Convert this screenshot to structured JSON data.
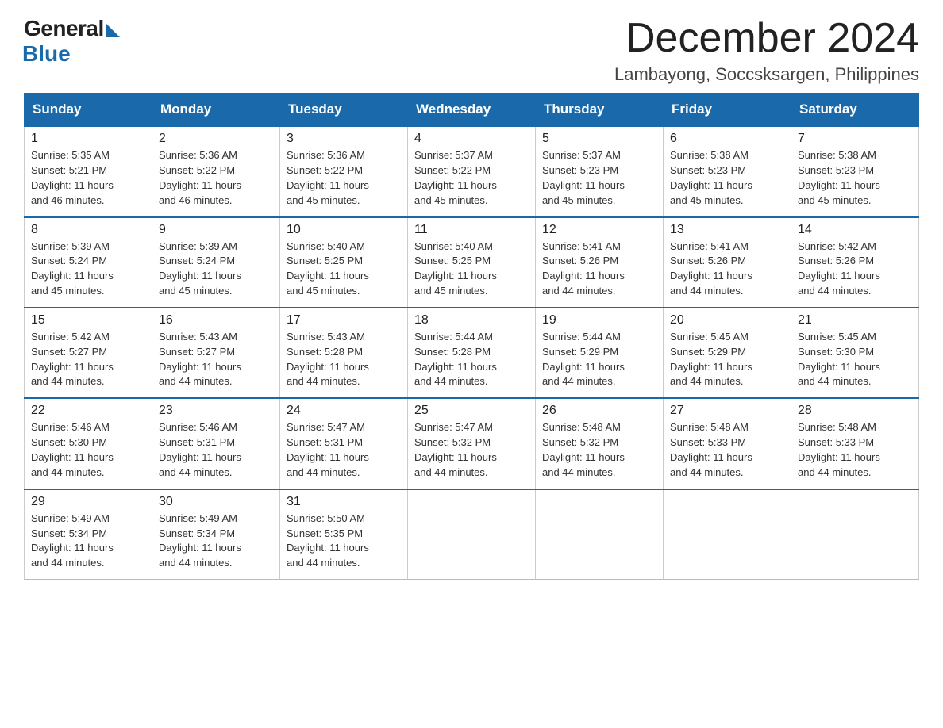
{
  "header": {
    "logo_general": "General",
    "logo_blue": "Blue",
    "month_title": "December 2024",
    "location": "Lambayong, Soccsksargen, Philippines"
  },
  "weekdays": [
    "Sunday",
    "Monday",
    "Tuesday",
    "Wednesday",
    "Thursday",
    "Friday",
    "Saturday"
  ],
  "weeks": [
    [
      {
        "day": "1",
        "sunrise": "5:35 AM",
        "sunset": "5:21 PM",
        "daylight": "11 hours and 46 minutes."
      },
      {
        "day": "2",
        "sunrise": "5:36 AM",
        "sunset": "5:22 PM",
        "daylight": "11 hours and 46 minutes."
      },
      {
        "day": "3",
        "sunrise": "5:36 AM",
        "sunset": "5:22 PM",
        "daylight": "11 hours and 45 minutes."
      },
      {
        "day": "4",
        "sunrise": "5:37 AM",
        "sunset": "5:22 PM",
        "daylight": "11 hours and 45 minutes."
      },
      {
        "day": "5",
        "sunrise": "5:37 AM",
        "sunset": "5:23 PM",
        "daylight": "11 hours and 45 minutes."
      },
      {
        "day": "6",
        "sunrise": "5:38 AM",
        "sunset": "5:23 PM",
        "daylight": "11 hours and 45 minutes."
      },
      {
        "day": "7",
        "sunrise": "5:38 AM",
        "sunset": "5:23 PM",
        "daylight": "11 hours and 45 minutes."
      }
    ],
    [
      {
        "day": "8",
        "sunrise": "5:39 AM",
        "sunset": "5:24 PM",
        "daylight": "11 hours and 45 minutes."
      },
      {
        "day": "9",
        "sunrise": "5:39 AM",
        "sunset": "5:24 PM",
        "daylight": "11 hours and 45 minutes."
      },
      {
        "day": "10",
        "sunrise": "5:40 AM",
        "sunset": "5:25 PM",
        "daylight": "11 hours and 45 minutes."
      },
      {
        "day": "11",
        "sunrise": "5:40 AM",
        "sunset": "5:25 PM",
        "daylight": "11 hours and 45 minutes."
      },
      {
        "day": "12",
        "sunrise": "5:41 AM",
        "sunset": "5:26 PM",
        "daylight": "11 hours and 44 minutes."
      },
      {
        "day": "13",
        "sunrise": "5:41 AM",
        "sunset": "5:26 PM",
        "daylight": "11 hours and 44 minutes."
      },
      {
        "day": "14",
        "sunrise": "5:42 AM",
        "sunset": "5:26 PM",
        "daylight": "11 hours and 44 minutes."
      }
    ],
    [
      {
        "day": "15",
        "sunrise": "5:42 AM",
        "sunset": "5:27 PM",
        "daylight": "11 hours and 44 minutes."
      },
      {
        "day": "16",
        "sunrise": "5:43 AM",
        "sunset": "5:27 PM",
        "daylight": "11 hours and 44 minutes."
      },
      {
        "day": "17",
        "sunrise": "5:43 AM",
        "sunset": "5:28 PM",
        "daylight": "11 hours and 44 minutes."
      },
      {
        "day": "18",
        "sunrise": "5:44 AM",
        "sunset": "5:28 PM",
        "daylight": "11 hours and 44 minutes."
      },
      {
        "day": "19",
        "sunrise": "5:44 AM",
        "sunset": "5:29 PM",
        "daylight": "11 hours and 44 minutes."
      },
      {
        "day": "20",
        "sunrise": "5:45 AM",
        "sunset": "5:29 PM",
        "daylight": "11 hours and 44 minutes."
      },
      {
        "day": "21",
        "sunrise": "5:45 AM",
        "sunset": "5:30 PM",
        "daylight": "11 hours and 44 minutes."
      }
    ],
    [
      {
        "day": "22",
        "sunrise": "5:46 AM",
        "sunset": "5:30 PM",
        "daylight": "11 hours and 44 minutes."
      },
      {
        "day": "23",
        "sunrise": "5:46 AM",
        "sunset": "5:31 PM",
        "daylight": "11 hours and 44 minutes."
      },
      {
        "day": "24",
        "sunrise": "5:47 AM",
        "sunset": "5:31 PM",
        "daylight": "11 hours and 44 minutes."
      },
      {
        "day": "25",
        "sunrise": "5:47 AM",
        "sunset": "5:32 PM",
        "daylight": "11 hours and 44 minutes."
      },
      {
        "day": "26",
        "sunrise": "5:48 AM",
        "sunset": "5:32 PM",
        "daylight": "11 hours and 44 minutes."
      },
      {
        "day": "27",
        "sunrise": "5:48 AM",
        "sunset": "5:33 PM",
        "daylight": "11 hours and 44 minutes."
      },
      {
        "day": "28",
        "sunrise": "5:48 AM",
        "sunset": "5:33 PM",
        "daylight": "11 hours and 44 minutes."
      }
    ],
    [
      {
        "day": "29",
        "sunrise": "5:49 AM",
        "sunset": "5:34 PM",
        "daylight": "11 hours and 44 minutes."
      },
      {
        "day": "30",
        "sunrise": "5:49 AM",
        "sunset": "5:34 PM",
        "daylight": "11 hours and 44 minutes."
      },
      {
        "day": "31",
        "sunrise": "5:50 AM",
        "sunset": "5:35 PM",
        "daylight": "11 hours and 44 minutes."
      },
      null,
      null,
      null,
      null
    ]
  ],
  "labels": {
    "sunrise": "Sunrise:",
    "sunset": "Sunset:",
    "daylight": "Daylight:"
  }
}
